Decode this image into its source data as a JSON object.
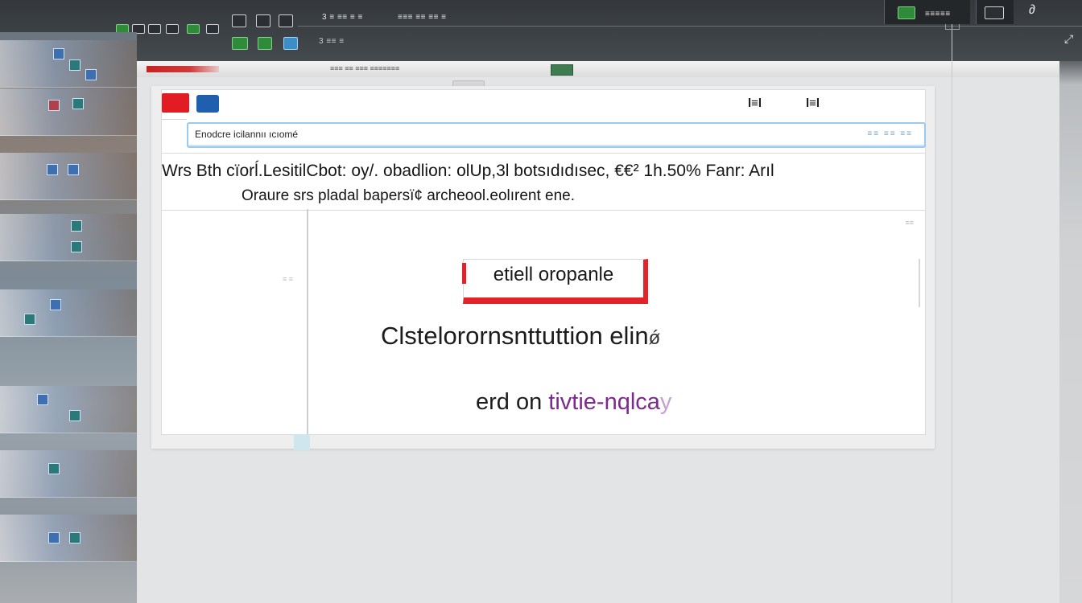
{
  "top_bar": {
    "left_labels": [
      "",
      "",
      ""
    ],
    "center_label_a": "3 ≡ ≡≡ ≡ ≡",
    "center_label_b": "≡≡≡ ≡≡ ≡≡ ≡",
    "sub_label": "3 ≡≡ ≡",
    "right_label": "≡≡≡≡≡",
    "right_glyph": "∂"
  },
  "window": {
    "tab_label": "≡≡≡ ≡≡ ≡≡≡ ≡≡≡≡≡≡≡"
  },
  "dialog": {
    "header_right_a": "l≡l",
    "header_right_b": "l≡l",
    "url_value": "Enodcre icilannıı ıcıomé",
    "url_hint": "≡≡ ≡≡ ≡≡",
    "message_line1": "Wrs Bth cïorĺ.LesitilCbot: oy/. obadlion: olUp,3l  botsıdıdısec, €€²  1h.50% Fanr: Arıl",
    "message_line2": "Oraure srs pladal bapersï¢ archeool.eolırent ene.",
    "action_button": "etiell oropanle",
    "status_text": "Clstelorornsnttuttion elin",
    "status_suffix": "ǿ",
    "tail_prefix": "erd on ",
    "tail_accent": "tivtie-nqlca",
    "tail_fade": "y",
    "side_faint": "≡ ≡",
    "corner_faint": "≡≡"
  },
  "colors": {
    "accent_red": "#e3232a",
    "accent_blue": "#1f5fae",
    "url_border": "#9cc9ee",
    "tail_purple": "#7c2a8e"
  }
}
